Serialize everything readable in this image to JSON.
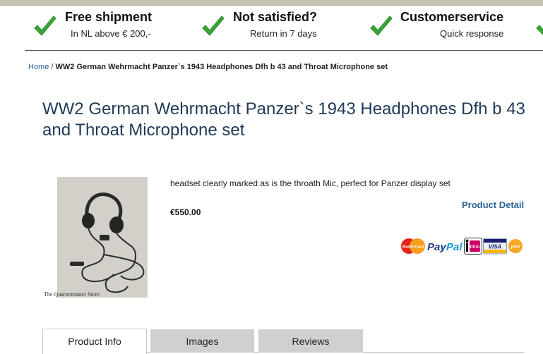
{
  "usps": [
    {
      "title": "Free shipment",
      "subtitle": "In NL above € 200,-"
    },
    {
      "title": "Not satisfied?",
      "subtitle": "Return in 7 days"
    },
    {
      "title": "Customerservice",
      "subtitle": "Quick response"
    }
  ],
  "breadcrumb": {
    "home": "Home",
    "separator": "/",
    "current": "WW2 German Wehrmacht Panzer`s 1943 Headphones Dfh b 43 and Throat Microphone set"
  },
  "product": {
    "title": "WW2 German Wehrmacht Panzer`s 1943 Headphones Dfh b 43 and Throat Microphone set",
    "image_watermark": "The Quartermaster Store",
    "description": "headset clearly marked as is the throath Mic, perfect for Panzer display set",
    "price": "€550.00",
    "detail_link": "Product Detail"
  },
  "payment_methods": {
    "mastercard": "MasterCard",
    "paypal_a": "Pay",
    "paypal_b": "Pal",
    "ideal": "iDEAL",
    "visa": "VISA",
    "postepay": "post"
  },
  "tabs": [
    {
      "label": "Product Info",
      "active": true
    },
    {
      "label": "Images",
      "active": false
    },
    {
      "label": "Reviews",
      "active": false
    }
  ],
  "colors": {
    "check_green": "#3aa635",
    "link_blue": "#2a6496",
    "title_navy": "#1f3a55",
    "tab_inactive": "#cfd1d1"
  }
}
